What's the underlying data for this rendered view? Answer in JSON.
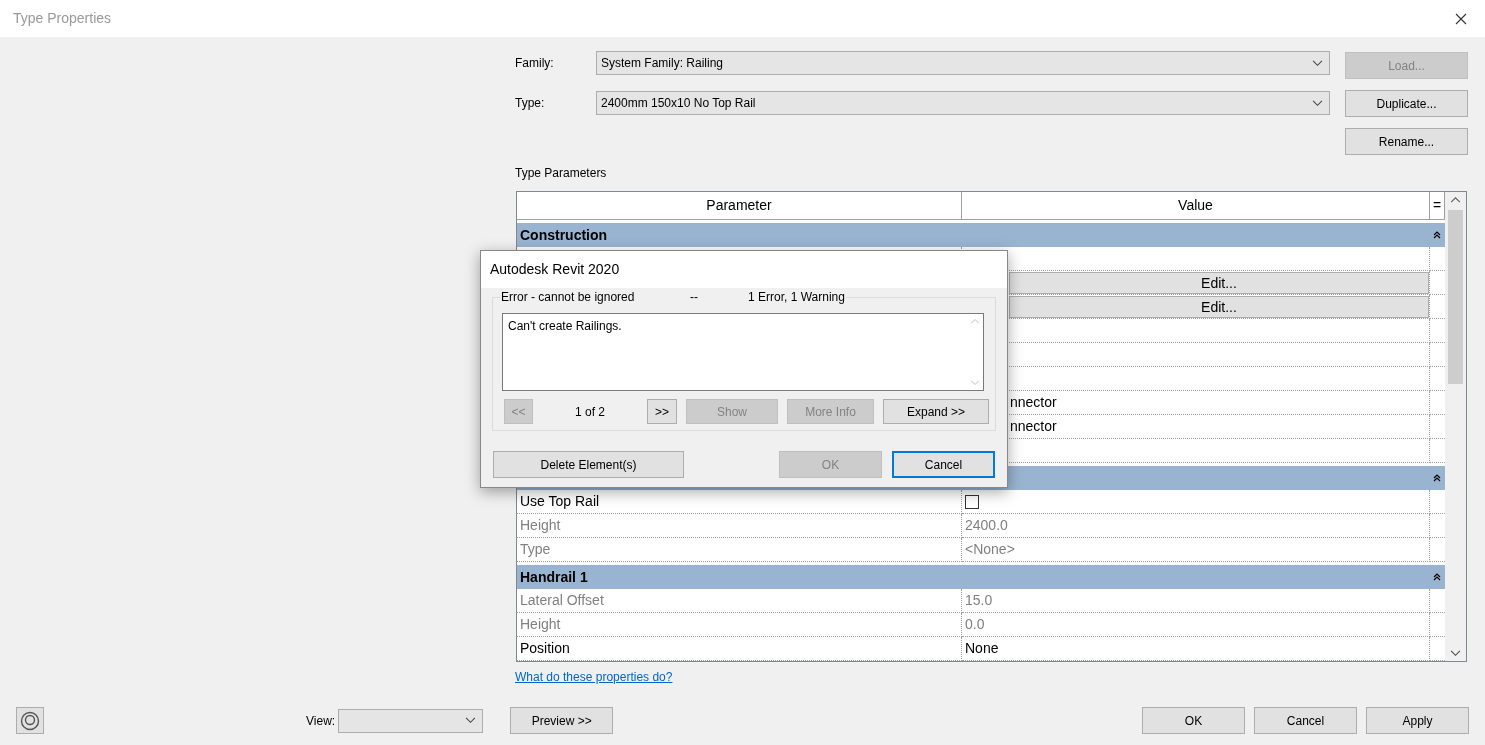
{
  "window": {
    "title": "Type Properties"
  },
  "family": {
    "label": "Family:",
    "value": "System Family: Railing"
  },
  "type": {
    "label": "Type:",
    "value": "2400mm 150x10 No Top Rail"
  },
  "side_buttons": [
    {
      "label": "Load...",
      "disabled": true
    },
    {
      "label": "Duplicate...",
      "disabled": false
    },
    {
      "label": "Rename...",
      "disabled": false
    }
  ],
  "section_label": "Type Parameters",
  "table": {
    "columns": [
      "Parameter",
      "Value",
      "="
    ],
    "groups": [
      {
        "name": "Construction",
        "expanded": true,
        "rows": [
          {
            "kind": "blank"
          },
          {
            "kind": "button",
            "value": "Edit..."
          },
          {
            "kind": "button",
            "value": "Edit..."
          },
          {
            "kind": "blank"
          },
          {
            "kind": "blank"
          },
          {
            "kind": "blank"
          },
          {
            "kind": "text",
            "value": "nnector",
            "disabled": false
          },
          {
            "kind": "text",
            "value": "nnector",
            "disabled": false
          },
          {
            "kind": "blank"
          }
        ]
      },
      {
        "expanded": true,
        "rows": [
          {
            "kind": "checkbox",
            "parameter": "Use Top Rail",
            "checked": false,
            "disabled": false
          },
          {
            "kind": "text",
            "parameter": "Height",
            "value": "2400.0",
            "disabled": true
          },
          {
            "kind": "text",
            "parameter": "Type",
            "value": "<None>",
            "disabled": true
          }
        ]
      },
      {
        "name": "Handrail 1",
        "expanded": true,
        "rows": [
          {
            "kind": "text",
            "parameter": "Lateral Offset",
            "value": "15.0",
            "disabled": true
          },
          {
            "kind": "text",
            "parameter": "Height",
            "value": "0.0",
            "disabled": true
          },
          {
            "kind": "text",
            "parameter": "Position",
            "value": "None",
            "disabled": false
          }
        ]
      }
    ]
  },
  "help_link": "What do these properties do?",
  "view": {
    "label": "View:"
  },
  "preview_button": "Preview >>",
  "buttons": [
    {
      "label": "OK"
    },
    {
      "label": "Cancel"
    },
    {
      "label": "Apply"
    }
  ],
  "dialog": {
    "title": "Autodesk Revit 2020",
    "legend": [
      "Error - cannot be ignored",
      "--",
      "1 Error, 1 Warning"
    ],
    "message": "Can't create Railings.",
    "nav": [
      {
        "kind": "button",
        "label": "<<",
        "disabled": true
      },
      {
        "kind": "counter",
        "label": "1 of 2"
      },
      {
        "kind": "button",
        "label": ">>",
        "disabled": false
      },
      {
        "kind": "button",
        "label": "Show",
        "disabled": true
      },
      {
        "kind": "button",
        "label": "More Info",
        "disabled": true
      },
      {
        "kind": "button",
        "label": "Expand >>",
        "disabled": false
      }
    ],
    "footer": [
      {
        "label": "Delete Element(s)",
        "disabled": false,
        "default": false
      },
      {
        "label": "OK",
        "disabled": true,
        "default": false
      },
      {
        "label": "Cancel",
        "disabled": false,
        "default": true
      }
    ]
  }
}
